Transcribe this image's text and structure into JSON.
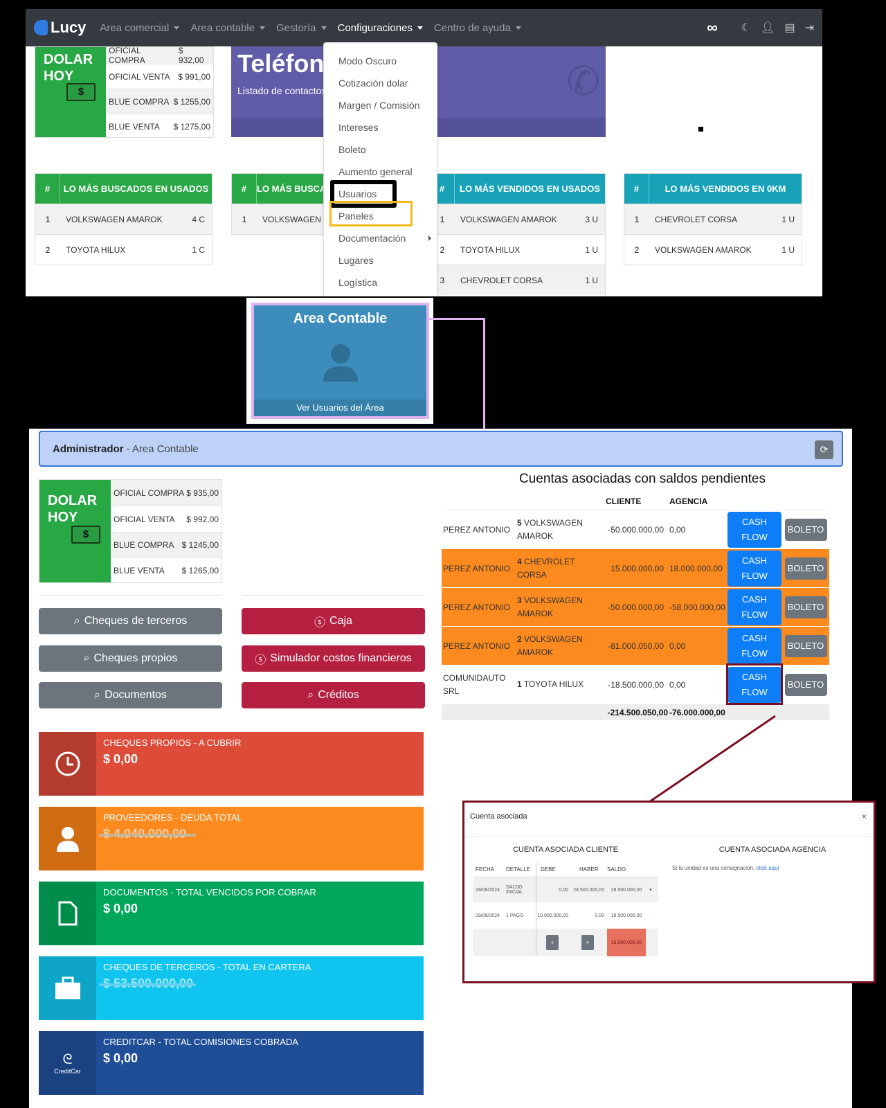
{
  "navbar": {
    "brand": "Lucy",
    "items": [
      {
        "label": "Area comercial"
      },
      {
        "label": "Area contable"
      },
      {
        "label": "Gestoría"
      },
      {
        "label": "Configuraciones"
      },
      {
        "label": "Centro de ayuda"
      }
    ],
    "right_icons": [
      "infinity-icon",
      "moon-icon",
      "user-icon",
      "calendar-icon",
      "logout-icon"
    ]
  },
  "dolar_top": {
    "title_line1": "DOLAR",
    "title_line2": "HOY",
    "rows": [
      {
        "label": "OFICIAL COMPRA",
        "value": "$ 932,00"
      },
      {
        "label": "OFICIAL VENTA",
        "value": "$ 991,00"
      },
      {
        "label": "BLUE COMPRA",
        "value": "$ 1255,00"
      },
      {
        "label": "BLUE VENTA",
        "value": "$ 1275,00"
      }
    ]
  },
  "telefonos": {
    "title": "Teléfonos",
    "subtitle": "Listado de contactos"
  },
  "config_menu": {
    "items": [
      "Modo Oscuro",
      "Cotización dolar",
      "Margen / Comisión",
      "Intereses",
      "Boleto",
      "Aumento general",
      "Usuarios",
      "Paneles",
      "Documentación",
      "Lugares",
      "Logística"
    ]
  },
  "rankings": [
    {
      "hash": "#",
      "title": "LO MÁS BUSCADOS EN USADOS",
      "rows": [
        {
          "n": "1",
          "name": "VOLKSWAGEN AMAROK",
          "count": "4 C"
        },
        {
          "n": "2",
          "name": "TOYOTA HILUX",
          "count": "1 C"
        }
      ]
    },
    {
      "hash": "#",
      "title": "LO MÁS BUSCADOS EN 0KM",
      "rows": [
        {
          "n": "1",
          "name": "VOLKSWAGEN AMAROK",
          "count": ""
        }
      ]
    },
    {
      "hash": "#",
      "title": "LO MÁS VENDIDOS EN USADOS",
      "rows": [
        {
          "n": "1",
          "name": "VOLKSWAGEN AMAROK",
          "count": "3 U"
        },
        {
          "n": "2",
          "name": "TOYOTA HILUX",
          "count": "1 U"
        },
        {
          "n": "3",
          "name": "CHEVROLET CORSA",
          "count": "1 U"
        }
      ]
    },
    {
      "hash": "#",
      "title": "LO MÁS VENDIDOS EN 0KM",
      "rows": [
        {
          "n": "1",
          "name": "CHEVROLET CORSA",
          "count": "1 U"
        },
        {
          "n": "2",
          "name": "VOLKSWAGEN AMAROK",
          "count": "1 U"
        }
      ]
    }
  ],
  "area_card": {
    "title": "Area Contable",
    "footer": "Ver Usuarios del Área"
  },
  "admin_bar": {
    "role": "Administrador",
    "area": "- Area Contable"
  },
  "dolar_bottom": {
    "title_line1": "DOLAR",
    "title_line2": "HOY",
    "rows": [
      {
        "label": "OFICIAL COMPRA",
        "value": "$ 935,00"
      },
      {
        "label": "OFICIAL VENTA",
        "value": "$ 992,00"
      },
      {
        "label": "BLUE COMPRA",
        "value": "$ 1245,00"
      },
      {
        "label": "BLUE VENTA",
        "value": "$ 1265,00"
      }
    ]
  },
  "buttons": {
    "cheques_terceros": "Cheques de terceros",
    "cheques_propios": "Cheques propios",
    "documentos": "Documentos",
    "caja": "Caja",
    "simulador": "Simulador costos financieros",
    "creditos": "Créditos"
  },
  "stats": [
    {
      "label": "CHEQUES PROPIOS - A CUBRIR",
      "value": "$ 0,00",
      "color": "#dd4b39",
      "icon_bg": "#b33c2e",
      "icon": "clock-icon"
    },
    {
      "label": "PROVEEDORES - DEUDA TOTAL",
      "value": "$ 4.040.000,00",
      "color": "#fd8a1f",
      "icon_bg": "#d06c12",
      "icon": "user-icon",
      "redacted": true
    },
    {
      "label": "DOCUMENTOS - TOTAL VENCIDOS POR COBRAR",
      "value": "$ 0,00",
      "color": "#00a65a",
      "icon_bg": "#008d4c",
      "icon": "file-icon"
    },
    {
      "label": "CHEQUES DE TERCEROS - TOTAL EN CARTERA",
      "value": "$ 53.500.000,00",
      "color": "#0fc5ef",
      "icon_bg": "#0ea5c8",
      "icon": "briefcase-icon",
      "redacted": true
    },
    {
      "label": "CREDITCAR - TOTAL COMISIONES COBRADA",
      "value": "$ 0,00",
      "color": "#1f4e96",
      "icon_bg": "#1a4180",
      "icon": "creditcar-logo"
    }
  ],
  "cuentas": {
    "title": "Cuentas asociadas con saldos pendientes",
    "headers": [
      "",
      "",
      "CLIENTE",
      "AGENCIA",
      "",
      ""
    ],
    "rows": [
      {
        "cliente": "PEREZ ANTONIO",
        "num": "5",
        "vehiculo": "VOLKSWAGEN AMAROK",
        "saldo_cliente": "-50.000.000,00",
        "saldo_agencia": "0,00",
        "highlight": false
      },
      {
        "cliente": "PEREZ ANTONIO",
        "num": "4",
        "vehiculo": "CHEVROLET CORSA",
        "saldo_cliente": "15.000.000,00",
        "saldo_agencia": "18.000.000,00",
        "highlight": true
      },
      {
        "cliente": "PEREZ ANTONIO",
        "num": "3",
        "vehiculo": "VOLKSWAGEN AMAROK",
        "saldo_cliente": "-50.000.000,00",
        "saldo_agencia": "-58.000.000,00",
        "highlight": true
      },
      {
        "cliente": "PEREZ ANTONIO",
        "num": "2",
        "vehiculo": "VOLKSWAGEN AMAROK",
        "saldo_cliente": "-81.000.050,00",
        "saldo_agencia": "0,00",
        "highlight": true
      },
      {
        "cliente": "COMUNIDAUTO SRL",
        "num": "1",
        "vehiculo": "TOYOTA HILUX",
        "saldo_cliente": "-18.500.000,00",
        "saldo_agencia": "0,00",
        "highlight": false
      }
    ],
    "cash_label_1": "CASH",
    "cash_label_2": "FLOW",
    "boleto_label": "BOLETO",
    "total_cliente": "-214.500.050,00",
    "total_agencia": "-76.000.000,00"
  },
  "modal": {
    "title": "Cuenta asociada",
    "close": "×",
    "cliente_head": "CUENTA ASOCIADA CLIENTE",
    "agencia_head": "CUENTA ASOCIADA AGENCIA",
    "columns": [
      "FECHA",
      "DETALLE",
      "DEBE",
      "HABER",
      "SALDO"
    ],
    "rows": [
      {
        "fecha": "29/08/2024",
        "detalle": "SALDO INICIAL",
        "debe": "0,00",
        "haber": "28.500.000,00",
        "saldo": "28.500.000,00",
        "arrow": "▾"
      },
      {
        "fecha": "29/08/2024",
        "detalle": "1 PAGO",
        "debe": "10.000.000,00",
        "haber": "0,00",
        "saldo": "18.500.000,00",
        "arrow": "·"
      }
    ],
    "plus": "+",
    "total_saldo": "18.500.000,00",
    "agency_text": "Si la unidad es una consignación,",
    "agency_link": "click aquí"
  }
}
